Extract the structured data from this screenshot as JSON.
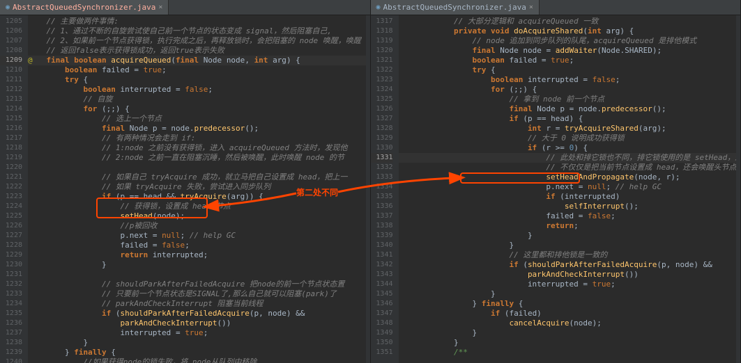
{
  "tabs": {
    "left": {
      "label": "AbstractQueuedSynchronizer.java",
      "close": "×"
    },
    "right": {
      "label": "AbstractQueuedSynchronizer.java",
      "close": "×"
    }
  },
  "left_lines": [
    "1205",
    "1206",
    "1207",
    "1208",
    "1209",
    "1210",
    "1211",
    "1212",
    "1213",
    "1214",
    "1215",
    "1216",
    "1217",
    "1218",
    "1219",
    "1220",
    "1221",
    "1222",
    "1223",
    "1224",
    "1225",
    "1226",
    "1227",
    "1228",
    "1229",
    "1230",
    "1231",
    "1232",
    "1233",
    "1234",
    "1235",
    "1236",
    "1237",
    "1238",
    "1239",
    "1240"
  ],
  "right_lines": [
    "1317",
    "1318",
    "1319",
    "1320",
    "1321",
    "1322",
    "1323",
    "1324",
    "1325",
    "1326",
    "1327",
    "1328",
    "1329",
    "1330",
    "1331",
    "1332",
    "1333",
    "1334",
    "1335",
    "1336",
    "1337",
    "1338",
    "1339",
    "1340",
    "1341",
    "1342",
    "1343",
    "1344",
    "1345",
    "1346",
    "1347",
    "1348",
    "1349",
    "1350",
    "1351"
  ],
  "left_hl": "1209",
  "right_hl": "1331",
  "annotation_label": "第二处不同",
  "left_code": [
    {
      "indent": 1,
      "tokens": [
        [
          "cmt",
          "// 主要做两件事情:"
        ]
      ]
    },
    {
      "indent": 1,
      "tokens": [
        [
          "cmt",
          "// 1、通过不断的自旋尝试使自己前一个节点的状态变成 signal，然后阻塞自己,"
        ]
      ]
    },
    {
      "indent": 1,
      "tokens": [
        [
          "cmt",
          "// 2、如果前一个节点获得锁，执行完成之后，再释放锁时，会把阻塞的 node 唤醒，唤醒"
        ]
      ]
    },
    {
      "indent": 1,
      "tokens": [
        [
          "cmt",
          "// 返回false表示获得锁成功，返回true表示失败"
        ]
      ]
    },
    {
      "indent": 0,
      "cur": true,
      "tokens": [
        [
          "at",
          "@   "
        ],
        [
          "kw",
          "final boolean "
        ],
        [
          "mtd",
          "acquireQueued"
        ],
        [
          "op",
          "("
        ],
        [
          "kw",
          "final "
        ],
        [
          "cls",
          "Node "
        ],
        [
          "ty",
          "node"
        ],
        [
          "op",
          ", "
        ],
        [
          "kw",
          "int "
        ],
        [
          "ty",
          "arg"
        ],
        [
          "op",
          ") {"
        ]
      ]
    },
    {
      "indent": 2,
      "tokens": [
        [
          "kw",
          "boolean "
        ],
        [
          "ty",
          "failed "
        ],
        [
          "op",
          "= "
        ],
        [
          "lit",
          "true"
        ],
        [
          "op",
          ";"
        ]
      ]
    },
    {
      "indent": 2,
      "tokens": [
        [
          "kw",
          "try "
        ],
        [
          "op",
          "{"
        ]
      ]
    },
    {
      "indent": 3,
      "tokens": [
        [
          "kw",
          "boolean "
        ],
        [
          "ty",
          "interrupted "
        ],
        [
          "op",
          "= "
        ],
        [
          "lit",
          "false"
        ],
        [
          "op",
          ";"
        ]
      ]
    },
    {
      "indent": 3,
      "tokens": [
        [
          "cmt",
          "// 自旋"
        ]
      ]
    },
    {
      "indent": 3,
      "tokens": [
        [
          "kw",
          "for "
        ],
        [
          "op",
          "(;;) {"
        ]
      ]
    },
    {
      "indent": 4,
      "tokens": [
        [
          "cmt",
          "// 选上一个节点"
        ]
      ]
    },
    {
      "indent": 4,
      "tokens": [
        [
          "kw",
          "final "
        ],
        [
          "cls",
          "Node "
        ],
        [
          "ty",
          "p "
        ],
        [
          "op",
          "= node."
        ],
        [
          "mtd",
          "predecessor"
        ],
        [
          "op",
          "();"
        ]
      ]
    },
    {
      "indent": 4,
      "tokens": [
        [
          "cmt",
          "// 有两种情况会走到 if:"
        ]
      ]
    },
    {
      "indent": 4,
      "tokens": [
        [
          "cmt",
          "// 1:node 之前没有获得锁，进入 acquireQueued 方法时，发现他"
        ]
      ]
    },
    {
      "indent": 4,
      "tokens": [
        [
          "cmt",
          "// 2:node 之前一直在阻塞沉睡，然后被唤醒，此时唤醒 node 的节"
        ]
      ]
    },
    {
      "indent": 4,
      "tokens": [
        [
          "cmt",
          ""
        ]
      ]
    },
    {
      "indent": 4,
      "tokens": [
        [
          "cmt",
          "// 如果自己 tryAcquire 成功，就立马把自己设置成 head，把上一"
        ]
      ]
    },
    {
      "indent": 4,
      "tokens": [
        [
          "cmt",
          "// 如果 tryAcquire 失败，尝试进入同步队列"
        ]
      ]
    },
    {
      "indent": 4,
      "tokens": [
        [
          "kw",
          "if "
        ],
        [
          "op",
          "(p == head && "
        ],
        [
          "mtd",
          "tryAcquire"
        ],
        [
          "op",
          "(arg)) {"
        ]
      ]
    },
    {
      "indent": 5,
      "tokens": [
        [
          "cmt",
          "// 获得锁，设置成 head 节点"
        ]
      ]
    },
    {
      "indent": 5,
      "tokens": [
        [
          "mtd",
          "setHead"
        ],
        [
          "op",
          "(node);"
        ]
      ]
    },
    {
      "indent": 5,
      "tokens": [
        [
          "cmt",
          "//p被回收"
        ]
      ]
    },
    {
      "indent": 5,
      "tokens": [
        [
          "ty",
          "p.next "
        ],
        [
          "op",
          "= "
        ],
        [
          "lit",
          "null"
        ],
        [
          "op",
          "; "
        ],
        [
          "cmt",
          "// help GC"
        ]
      ]
    },
    {
      "indent": 5,
      "tokens": [
        [
          "ty",
          "failed "
        ],
        [
          "op",
          "= "
        ],
        [
          "lit",
          "false"
        ],
        [
          "op",
          ";"
        ]
      ]
    },
    {
      "indent": 5,
      "tokens": [
        [
          "kw",
          "return "
        ],
        [
          "ty",
          "interrupted"
        ],
        [
          "op",
          ";"
        ]
      ]
    },
    {
      "indent": 4,
      "tokens": [
        [
          "op",
          "}"
        ]
      ]
    },
    {
      "indent": 4,
      "tokens": [
        [
          "cmt",
          ""
        ]
      ]
    },
    {
      "indent": 4,
      "tokens": [
        [
          "cmt",
          "// shouldParkAfterFailedAcquire 把node的前一个节点状态置"
        ]
      ]
    },
    {
      "indent": 4,
      "tokens": [
        [
          "cmt",
          "// 只要前一个节点状态是SIGNAL了,那么自己就可以阻塞(park)了"
        ]
      ]
    },
    {
      "indent": 4,
      "tokens": [
        [
          "cmt",
          "// parkAndCheckInterrupt 阻塞当前线程"
        ]
      ]
    },
    {
      "indent": 4,
      "tokens": [
        [
          "kw",
          "if "
        ],
        [
          "op",
          "("
        ],
        [
          "mtd",
          "shouldParkAfterFailedAcquire"
        ],
        [
          "op",
          "(p, node) &&"
        ]
      ]
    },
    {
      "indent": 5,
      "tokens": [
        [
          "mtd",
          "parkAndCheckInterrupt"
        ],
        [
          "op",
          "())"
        ]
      ]
    },
    {
      "indent": 5,
      "tokens": [
        [
          "ty",
          "interrupted "
        ],
        [
          "op",
          "= "
        ],
        [
          "lit",
          "true"
        ],
        [
          "op",
          ";"
        ]
      ]
    },
    {
      "indent": 3,
      "tokens": [
        [
          "op",
          "}"
        ]
      ]
    },
    {
      "indent": 2,
      "tokens": [
        [
          "op",
          "} "
        ],
        [
          "kw",
          "finally "
        ],
        [
          "op",
          "{"
        ]
      ]
    },
    {
      "indent": 3,
      "tokens": [
        [
          "cmt",
          "//如果获得node的锁失败，将 node从队列中移除"
        ]
      ]
    }
  ],
  "right_code": [
    {
      "indent": 3,
      "tokens": [
        [
          "cmt",
          "// 大部分逻辑和 acquireQueued 一致"
        ]
      ]
    },
    {
      "indent": 3,
      "tokens": [
        [
          "kw",
          "private void "
        ],
        [
          "mtd",
          "doAcquireShared"
        ],
        [
          "op",
          "("
        ],
        [
          "kw",
          "int "
        ],
        [
          "ty",
          "arg"
        ],
        [
          "op",
          ") {"
        ]
      ]
    },
    {
      "indent": 4,
      "tokens": [
        [
          "cmt",
          "// node 追加到同步队列的队尾，acquireQueued 是排他模式"
        ]
      ]
    },
    {
      "indent": 4,
      "tokens": [
        [
          "kw",
          "final "
        ],
        [
          "cls",
          "Node "
        ],
        [
          "ty",
          "node "
        ],
        [
          "op",
          "= "
        ],
        [
          "mtd",
          "addWaiter"
        ],
        [
          "op",
          "(Node."
        ],
        [
          "ty",
          "SHARED"
        ],
        [
          "op",
          ");"
        ]
      ]
    },
    {
      "indent": 4,
      "tokens": [
        [
          "kw",
          "boolean "
        ],
        [
          "ty",
          "failed "
        ],
        [
          "op",
          "= "
        ],
        [
          "lit",
          "true"
        ],
        [
          "op",
          ";"
        ]
      ]
    },
    {
      "indent": 4,
      "tokens": [
        [
          "kw",
          "try "
        ],
        [
          "op",
          "{"
        ]
      ]
    },
    {
      "indent": 5,
      "tokens": [
        [
          "kw",
          "boolean "
        ],
        [
          "ty",
          "interrupted "
        ],
        [
          "op",
          "= "
        ],
        [
          "lit",
          "false"
        ],
        [
          "op",
          ";"
        ]
      ]
    },
    {
      "indent": 5,
      "tokens": [
        [
          "kw",
          "for "
        ],
        [
          "op",
          "(;;) {"
        ]
      ]
    },
    {
      "indent": 6,
      "tokens": [
        [
          "cmt",
          "// 拿到 node 前一个节点"
        ]
      ]
    },
    {
      "indent": 6,
      "tokens": [
        [
          "kw",
          "final "
        ],
        [
          "cls",
          "Node "
        ],
        [
          "ty",
          "p "
        ],
        [
          "op",
          "= node."
        ],
        [
          "mtd",
          "predecessor"
        ],
        [
          "op",
          "();"
        ]
      ]
    },
    {
      "indent": 6,
      "tokens": [
        [
          "kw",
          "if "
        ],
        [
          "op",
          "(p == head) {"
        ]
      ]
    },
    {
      "indent": 7,
      "tokens": [
        [
          "kw",
          "int "
        ],
        [
          "ty",
          "r "
        ],
        [
          "op",
          "= "
        ],
        [
          "mtd",
          "tryAcquireShared"
        ],
        [
          "op",
          "(arg);"
        ]
      ]
    },
    {
      "indent": 7,
      "tokens": [
        [
          "cmt",
          "// 大于 0 说明成功获得锁"
        ]
      ]
    },
    {
      "indent": 7,
      "tokens": [
        [
          "kw",
          "if "
        ],
        [
          "op",
          "(r "
        ],
        [
          "op",
          ">= "
        ],
        [
          "num",
          "0"
        ],
        [
          "op",
          ") {"
        ]
      ]
    },
    {
      "indent": 8,
      "cur": true,
      "tokens": [
        [
          "cmt",
          "// 此处和排它锁也不同，排它锁使用的是 setHead，这里的 setHeadAndPropagate 方法"
        ]
      ]
    },
    {
      "indent": 8,
      "tokens": [
        [
          "cmt",
          "// 不仅仅是把当前节点设置成 head，还会唤醒头节点的后续节点"
        ]
      ]
    },
    {
      "indent": 8,
      "tokens": [
        [
          "mtd",
          "setHeadAndPropagate"
        ],
        [
          "op",
          "(node, r);"
        ]
      ]
    },
    {
      "indent": 8,
      "tokens": [
        [
          "ty",
          "p.next "
        ],
        [
          "op",
          "= "
        ],
        [
          "lit",
          "null"
        ],
        [
          "op",
          "; "
        ],
        [
          "cmt",
          "// help GC"
        ]
      ]
    },
    {
      "indent": 8,
      "tokens": [
        [
          "kw",
          "if "
        ],
        [
          "op",
          "(interrupted)"
        ]
      ]
    },
    {
      "indent": 9,
      "tokens": [
        [
          "mtd",
          "selfInterrupt"
        ],
        [
          "op",
          "();"
        ]
      ]
    },
    {
      "indent": 8,
      "tokens": [
        [
          "ty",
          "failed "
        ],
        [
          "op",
          "= "
        ],
        [
          "lit",
          "false"
        ],
        [
          "op",
          ";"
        ]
      ]
    },
    {
      "indent": 8,
      "tokens": [
        [
          "kw",
          "return"
        ],
        [
          "op",
          ";"
        ]
      ]
    },
    {
      "indent": 7,
      "tokens": [
        [
          "op",
          "}"
        ]
      ]
    },
    {
      "indent": 6,
      "tokens": [
        [
          "op",
          "}"
        ]
      ]
    },
    {
      "indent": 6,
      "tokens": [
        [
          "cmt",
          "// 这里都和排他锁是一致的"
        ]
      ]
    },
    {
      "indent": 6,
      "tokens": [
        [
          "kw",
          "if "
        ],
        [
          "op",
          "("
        ],
        [
          "mtd",
          "shouldParkAfterFailedAcquire"
        ],
        [
          "op",
          "(p, node) &&"
        ]
      ]
    },
    {
      "indent": 7,
      "tokens": [
        [
          "mtd",
          "parkAndCheckInterrupt"
        ],
        [
          "op",
          "())"
        ]
      ]
    },
    {
      "indent": 7,
      "tokens": [
        [
          "ty",
          "interrupted "
        ],
        [
          "op",
          "= "
        ],
        [
          "lit",
          "true"
        ],
        [
          "op",
          ";"
        ]
      ]
    },
    {
      "indent": 5,
      "tokens": [
        [
          "op",
          "}"
        ]
      ]
    },
    {
      "indent": 4,
      "tokens": [
        [
          "op",
          "} "
        ],
        [
          "kw",
          "finally "
        ],
        [
          "op",
          "{"
        ]
      ]
    },
    {
      "indent": 5,
      "tokens": [
        [
          "kw",
          "if "
        ],
        [
          "op",
          "(failed)"
        ]
      ]
    },
    {
      "indent": 6,
      "tokens": [
        [
          "mtd",
          "cancelAcquire"
        ],
        [
          "op",
          "(node);"
        ]
      ]
    },
    {
      "indent": 4,
      "tokens": [
        [
          "op",
          "}"
        ]
      ]
    },
    {
      "indent": 3,
      "tokens": [
        [
          "op",
          "}"
        ]
      ]
    },
    {
      "indent": 3,
      "tokens": [
        [
          "doc",
          "/**"
        ]
      ]
    }
  ]
}
